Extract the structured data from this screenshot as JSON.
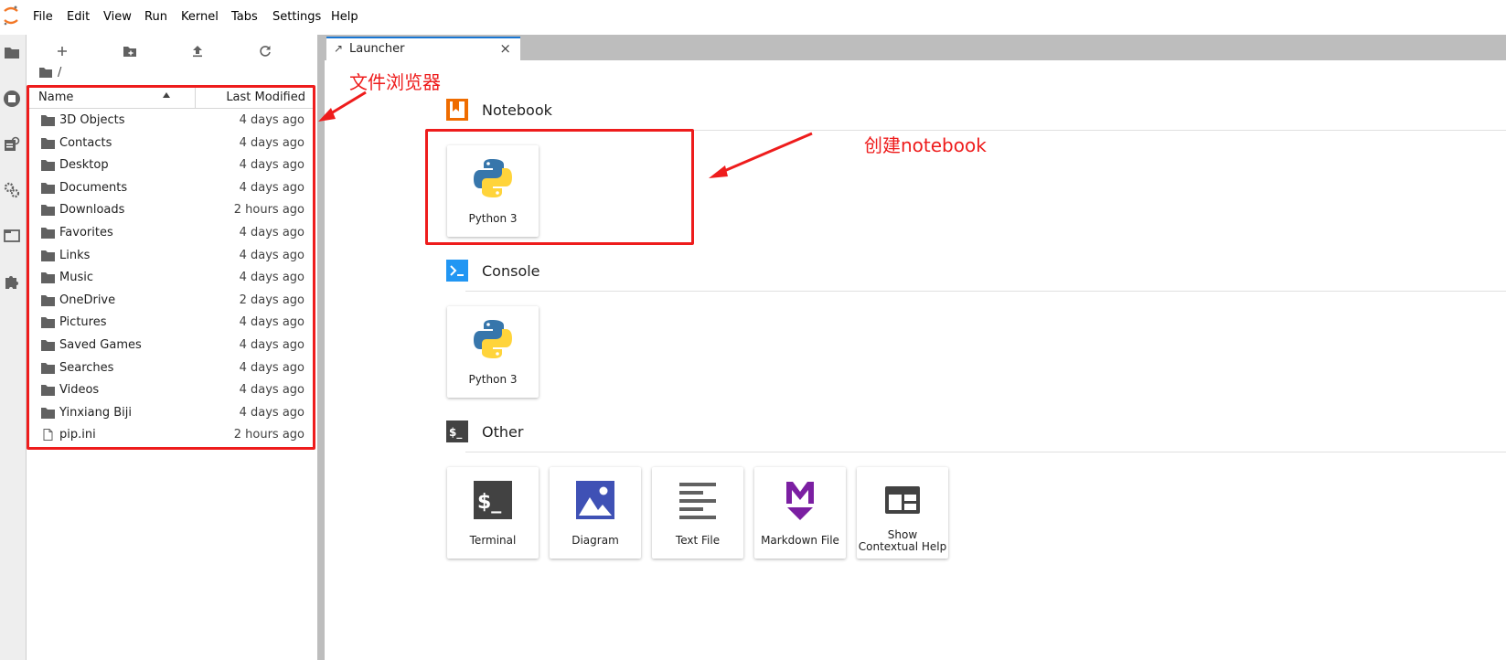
{
  "menu": [
    "File",
    "Edit",
    "View",
    "Run",
    "Kernel",
    "Tabs",
    "Settings",
    "Help"
  ],
  "filebrowser": {
    "breadcrumb": "/",
    "header": {
      "name": "Name",
      "modified": "Last Modified"
    },
    "files": [
      {
        "name": "3D Objects",
        "modified": "4 days ago",
        "type": "folder"
      },
      {
        "name": "Contacts",
        "modified": "4 days ago",
        "type": "folder"
      },
      {
        "name": "Desktop",
        "modified": "4 days ago",
        "type": "folder"
      },
      {
        "name": "Documents",
        "modified": "4 days ago",
        "type": "folder"
      },
      {
        "name": "Downloads",
        "modified": "2 hours ago",
        "type": "folder"
      },
      {
        "name": "Favorites",
        "modified": "4 days ago",
        "type": "folder"
      },
      {
        "name": "Links",
        "modified": "4 days ago",
        "type": "folder"
      },
      {
        "name": "Music",
        "modified": "4 days ago",
        "type": "folder"
      },
      {
        "name": "OneDrive",
        "modified": "2 days ago",
        "type": "folder"
      },
      {
        "name": "Pictures",
        "modified": "4 days ago",
        "type": "folder"
      },
      {
        "name": "Saved Games",
        "modified": "4 days ago",
        "type": "folder"
      },
      {
        "name": "Searches",
        "modified": "4 days ago",
        "type": "folder"
      },
      {
        "name": "Videos",
        "modified": "4 days ago",
        "type": "folder"
      },
      {
        "name": "Yinxiang Biji",
        "modified": "4 days ago",
        "type": "folder"
      },
      {
        "name": "pip.ini",
        "modified": "2 hours ago",
        "type": "file"
      }
    ]
  },
  "tab": {
    "label": "Launcher",
    "close": "×"
  },
  "launcher": {
    "notebook": {
      "title": "Notebook",
      "cards": [
        {
          "label": "Python 3"
        }
      ]
    },
    "console": {
      "title": "Console",
      "cards": [
        {
          "label": "Python 3"
        }
      ]
    },
    "other": {
      "title": "Other",
      "cards": [
        {
          "label": "Terminal"
        },
        {
          "label": "Diagram"
        },
        {
          "label": "Text File"
        },
        {
          "label": "Markdown File"
        },
        {
          "label": "Show Contextual Help"
        }
      ]
    }
  },
  "annotations": {
    "file_browser": "文件浏览器",
    "create_notebook": "创建notebook"
  },
  "colors": {
    "annotation": "#ee1c1c",
    "accent": "#1976d2",
    "notebook": "#ef6c00",
    "console": "#2196f3",
    "markdown": "#7b1fa2",
    "diagram": "#3f51b5"
  }
}
